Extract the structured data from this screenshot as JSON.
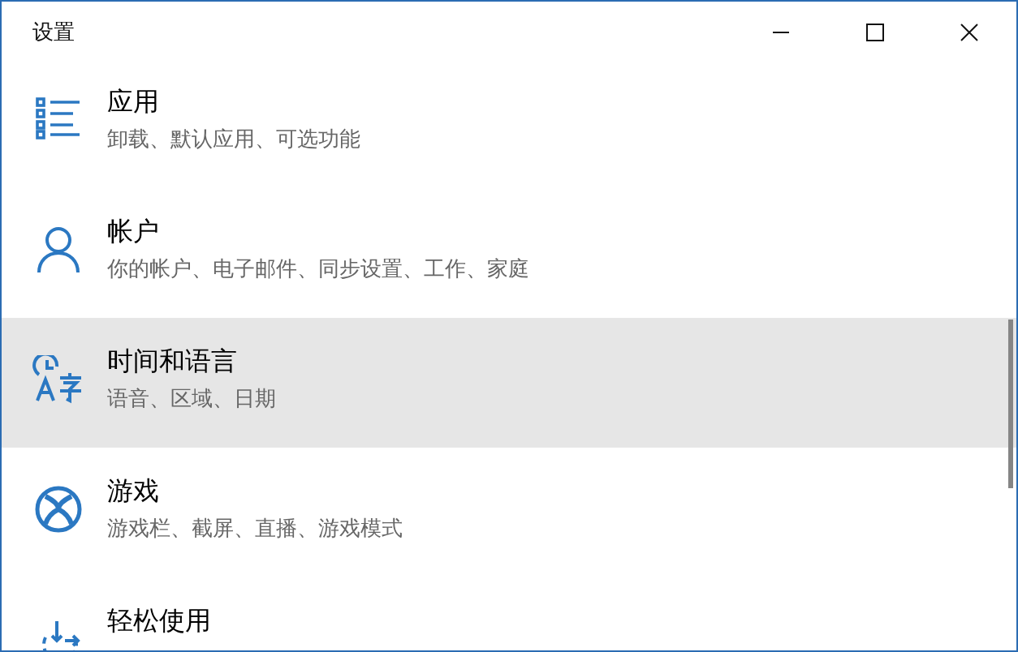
{
  "window": {
    "title": "设置"
  },
  "items": [
    {
      "kind": "apps",
      "title": "应用",
      "subtitle": "卸载、默认应用、可选功能",
      "selected": false
    },
    {
      "kind": "accounts",
      "title": "帐户",
      "subtitle": "你的帐户、电子邮件、同步设置、工作、家庭",
      "selected": false
    },
    {
      "kind": "time-language",
      "title": "时间和语言",
      "subtitle": "语音、区域、日期",
      "selected": true
    },
    {
      "kind": "gaming",
      "title": "游戏",
      "subtitle": "游戏栏、截屏、直播、游戏模式",
      "selected": false
    },
    {
      "kind": "ease-of-access",
      "title": "轻松使用",
      "selected": false
    }
  ]
}
